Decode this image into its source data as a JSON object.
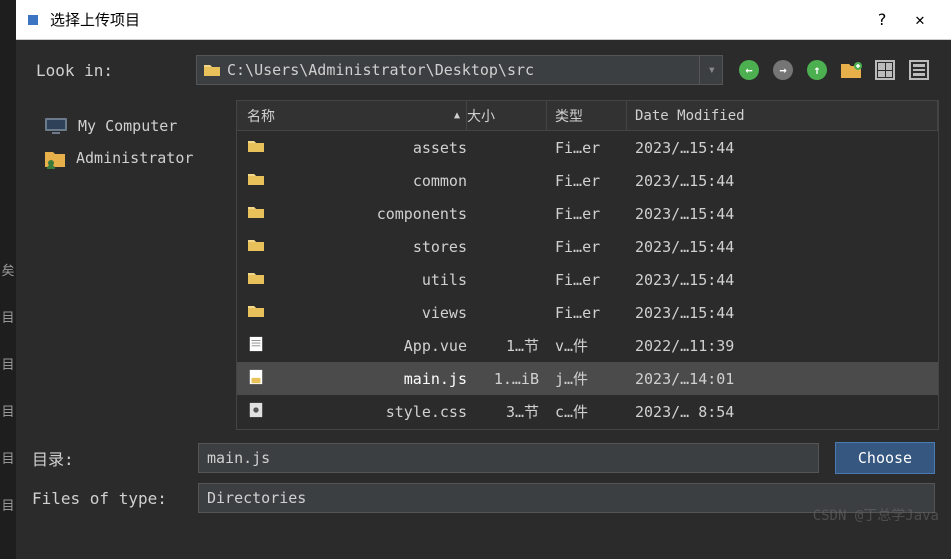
{
  "window": {
    "title": "选择上传项目",
    "help": "?",
    "close": "✕"
  },
  "toolbar": {
    "lookin_label": "Look in:",
    "path": "C:\\Users\\Administrator\\Desktop\\src"
  },
  "sidebar": {
    "items": [
      {
        "label": "My Computer",
        "icon": "computer-icon"
      },
      {
        "label": "Administrator",
        "icon": "user-folder-icon"
      }
    ]
  },
  "columns": {
    "name": "名称",
    "size": "大小",
    "type": "类型",
    "date": "Date Modified"
  },
  "files": [
    {
      "name": "assets",
      "size": "",
      "type": "Fi…er",
      "date": "2023/…15:44",
      "kind": "folder",
      "selected": false
    },
    {
      "name": "common",
      "size": "",
      "type": "Fi…er",
      "date": "2023/…15:44",
      "kind": "folder",
      "selected": false
    },
    {
      "name": "components",
      "size": "",
      "type": "Fi…er",
      "date": "2023/…15:44",
      "kind": "folder",
      "selected": false
    },
    {
      "name": "stores",
      "size": "",
      "type": "Fi…er",
      "date": "2023/…15:44",
      "kind": "folder",
      "selected": false
    },
    {
      "name": "utils",
      "size": "",
      "type": "Fi…er",
      "date": "2023/…15:44",
      "kind": "folder",
      "selected": false
    },
    {
      "name": "views",
      "size": "",
      "type": "Fi…er",
      "date": "2023/…15:44",
      "kind": "folder",
      "selected": false
    },
    {
      "name": "App.vue",
      "size": "1…节",
      "type": "v…件",
      "date": "2022/…11:39",
      "kind": "file",
      "selected": false
    },
    {
      "name": "main.js",
      "size": "1.…iB",
      "type": "j…件",
      "date": "2023/…14:01",
      "kind": "js",
      "selected": true
    },
    {
      "name": "style.css",
      "size": "3…节",
      "type": "c…件",
      "date": "2023/… 8:54",
      "kind": "css",
      "selected": false
    }
  ],
  "form": {
    "dir_label": "目录:",
    "dir_value": "main.js",
    "type_label": "Files of type:",
    "type_value": "Directories",
    "choose": "Choose"
  },
  "left_gutter": [
    "矣",
    "目",
    "目",
    "目",
    "目",
    "目"
  ],
  "watermark": "CSDN @丁总学Java"
}
